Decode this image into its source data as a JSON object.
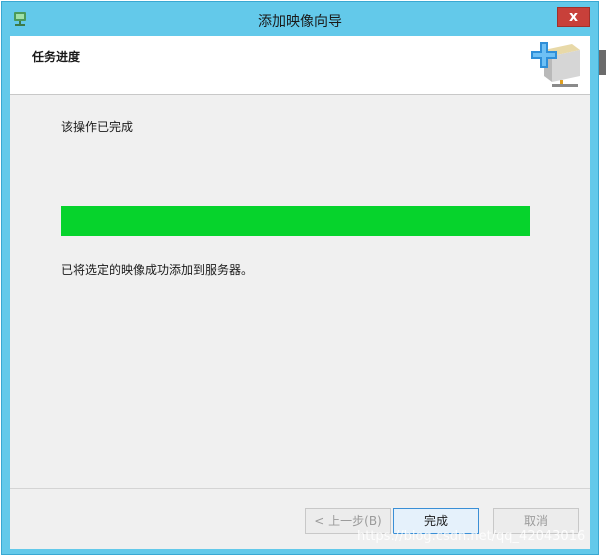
{
  "window": {
    "title": "添加映像向导",
    "close_label": "x"
  },
  "header": {
    "title": "任务进度",
    "icon": "add-image-icon"
  },
  "main": {
    "status": "该操作已完成",
    "progress_percent": 100,
    "result": "已将选定的映像成功添加到服务器。"
  },
  "buttons": {
    "back": "< 上一步(B)",
    "finish": "完成",
    "cancel": "取消"
  },
  "watermark": "https://blog.csdn.net/qq_42043016",
  "colors": {
    "titlebar": "#63c9ea",
    "progress": "#06d32c",
    "close": "#c8403a"
  }
}
